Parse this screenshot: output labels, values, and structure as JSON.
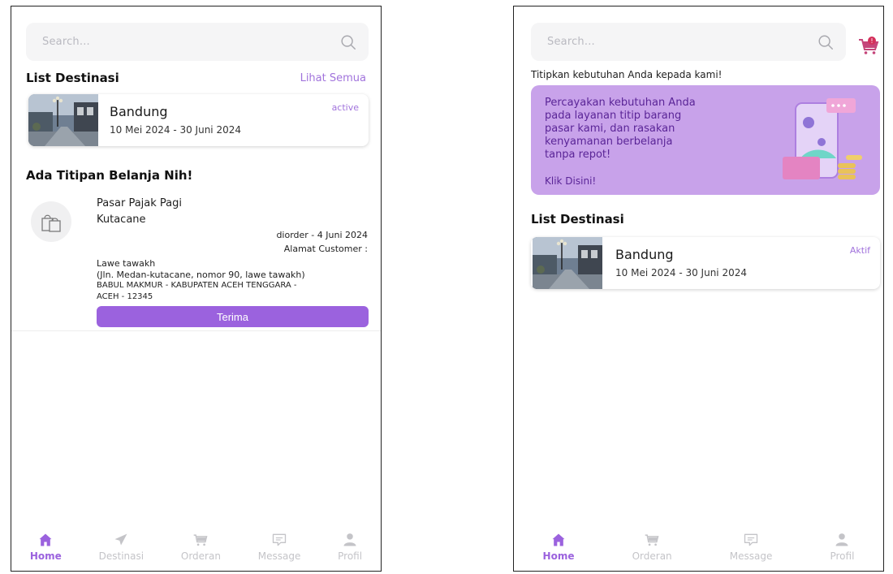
{
  "left": {
    "search_placeholder": "Search...",
    "list_title": "List Destinasi",
    "see_all": "Lihat Semua",
    "destination": {
      "name": "Bandung",
      "dates": "10 Mei 2024 - 30 Juni 2024",
      "status": "active"
    },
    "order_section_title": "Ada Titipan Belanja Nih!",
    "order": {
      "market": "Pasar Pajak Pagi",
      "city": "Kutacane",
      "ordered": "diorder - 4 Juni 2024",
      "address_label": "Alamat Customer :",
      "address_line1": "Lawe tawakh",
      "address_line2": "(Jln. Medan-kutacane, nomor 90, lawe tawakh)",
      "address_line3": "BABUL MAKMUR - KABUPATEN ACEH TENGGARA -",
      "address_line4": "ACEH - 12345",
      "accept_label": "Terima"
    },
    "nav": [
      "Home",
      "Destinasi",
      "Orderan",
      "Message",
      "Profil"
    ]
  },
  "right": {
    "search_placeholder": "Search...",
    "cart_badge": "!",
    "intro": "Titipkan kebutuhan Anda kepada kami!",
    "banner_lines": [
      "Percayakan kebutuhan Anda",
      "pada layanan titip barang",
      "pasar kami, dan rasakan",
      "kenyamanan berbelanja",
      "tanpa repot!"
    ],
    "banner_link": "Klik Disini!",
    "list_title": "List Destinasi",
    "destination": {
      "name": "Bandung",
      "dates": "10 Mei 2024 - 30 Juni 2024",
      "status": "Aktif"
    },
    "nav": [
      "Home",
      "Orderan",
      "Message",
      "Profil"
    ]
  },
  "colors": {
    "accent": "#9b62de",
    "banner": "#c8a2ea",
    "banner_text": "#5a2597",
    "nav_inactive": "#c4c4c8"
  },
  "icons": {
    "search": "search-icon",
    "cart": "cart-icon",
    "home": "home-icon",
    "destinasi": "send-icon",
    "orderan": "cart-icon",
    "message": "chat-icon",
    "profil": "user-icon",
    "order": "shopping-bags-icon"
  }
}
